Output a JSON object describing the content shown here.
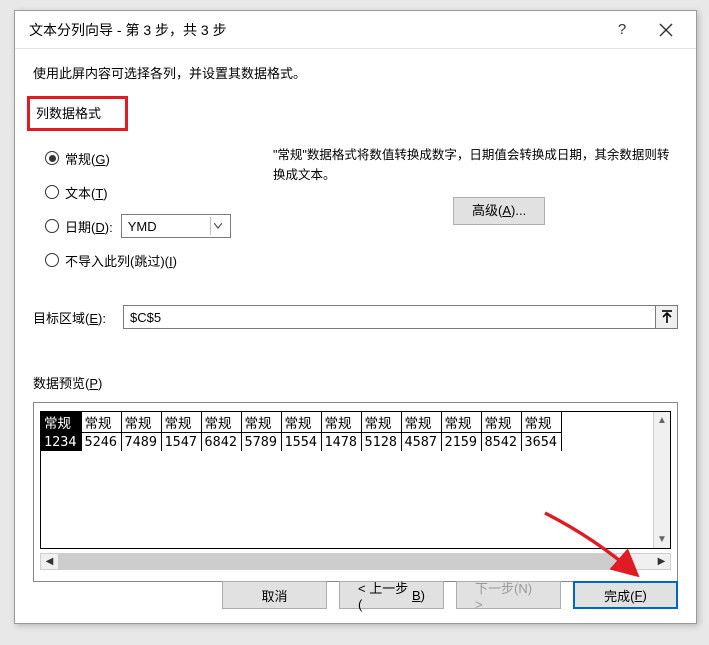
{
  "title": "文本分列向导 - 第 3 步，共 3 步",
  "instruction": "使用此屏内容可选择各列，并设置其数据格式。",
  "group_label": "列数据格式",
  "radios": {
    "general": {
      "label": "常规(",
      "hotkey": "G",
      "suffix": ")",
      "checked": true
    },
    "text": {
      "label": "文本(",
      "hotkey": "T",
      "suffix": ")",
      "checked": false
    },
    "date": {
      "label": "日期(",
      "hotkey": "D",
      "suffix": "):",
      "checked": false,
      "value": "YMD"
    },
    "skip": {
      "label": "不导入此列(跳过)(",
      "hotkey": "I",
      "suffix": ")",
      "checked": false
    }
  },
  "desc_line1": "\"常规\"数据格式将数值转换成数字，日期值会转换成日期，其余数据则转换成文本。",
  "advanced_label": "高级(A)...",
  "dest_label": "目标区域(E):",
  "dest_value": "$C$5",
  "preview_label": "数据预览(P)",
  "preview": {
    "headers": [
      "常规",
      "常规",
      "常规",
      "常规",
      "常规",
      "常规",
      "常规",
      "常规",
      "常规",
      "常规",
      "常规",
      "常规",
      "常规"
    ],
    "row": [
      "1234",
      "5246",
      "7489",
      "1547",
      "6842",
      "5789",
      "1554",
      "1478",
      "5128",
      "4587",
      "2159",
      "8542",
      "3654"
    ],
    "selected_col": 0
  },
  "buttons": {
    "cancel": "取消",
    "back": "< 上一步(B)",
    "next": "下一步(N) >",
    "finish": "完成(F)"
  }
}
